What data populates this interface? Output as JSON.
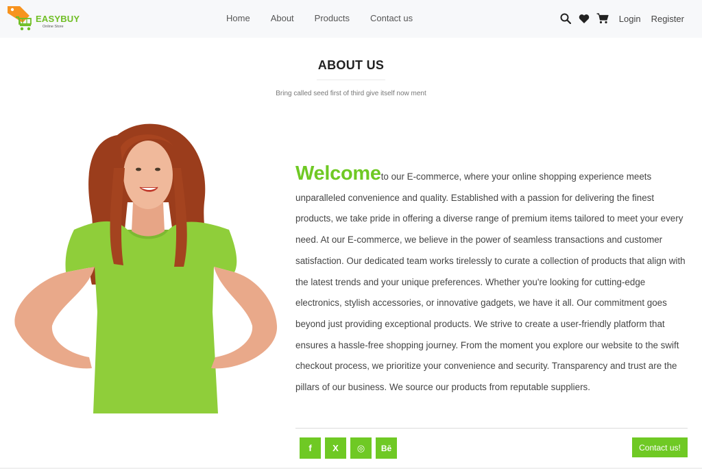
{
  "brand": {
    "name": "EASYBUY",
    "tagline": "Online Store",
    "colors": {
      "primary": "#6fc924",
      "logo_tag": "#f7931e",
      "logo_cart": "#6fbe24"
    }
  },
  "nav": {
    "links": [
      "Home",
      "About",
      "Products",
      "Contact us"
    ],
    "icons": [
      "search-icon",
      "heart-icon",
      "cart-icon"
    ],
    "login_label": "Login",
    "register_label": "Register"
  },
  "about": {
    "title": "ABOUT US",
    "subtitle": "Bring called seed first of third give itself now ment",
    "welcome_word": "Welcome",
    "body": "to our E-commerce, where your online shopping experience meets unparalleled convenience and quality. Established with a passion for delivering the finest products, we take pride in offering a diverse range of premium items tailored to meet your every need. At our E-commerce, we believe in the power of seamless transactions and customer satisfaction. Our dedicated team works tirelessly to curate a collection of products that align with the latest trends and your unique preferences. Whether you're looking for cutting-edge electronics, stylish accessories, or innovative gadgets, we have it all. Our commitment goes beyond just providing exceptional products. We strive to create a user-friendly platform that ensures a hassle-free shopping journey. From the moment you explore our website to the swift checkout process, we prioritize your convenience and security. Transparency and trust are the pillars of our business. We source our products from reputable suppliers."
  },
  "social": {
    "buttons": [
      {
        "icon": "facebook-icon",
        "glyph": "f"
      },
      {
        "icon": "x-icon",
        "glyph": "X"
      },
      {
        "icon": "dribbble-icon",
        "glyph": "◎"
      },
      {
        "icon": "behance-icon",
        "glyph": "Bē"
      }
    ]
  },
  "contact_button_label": "Contact us!"
}
